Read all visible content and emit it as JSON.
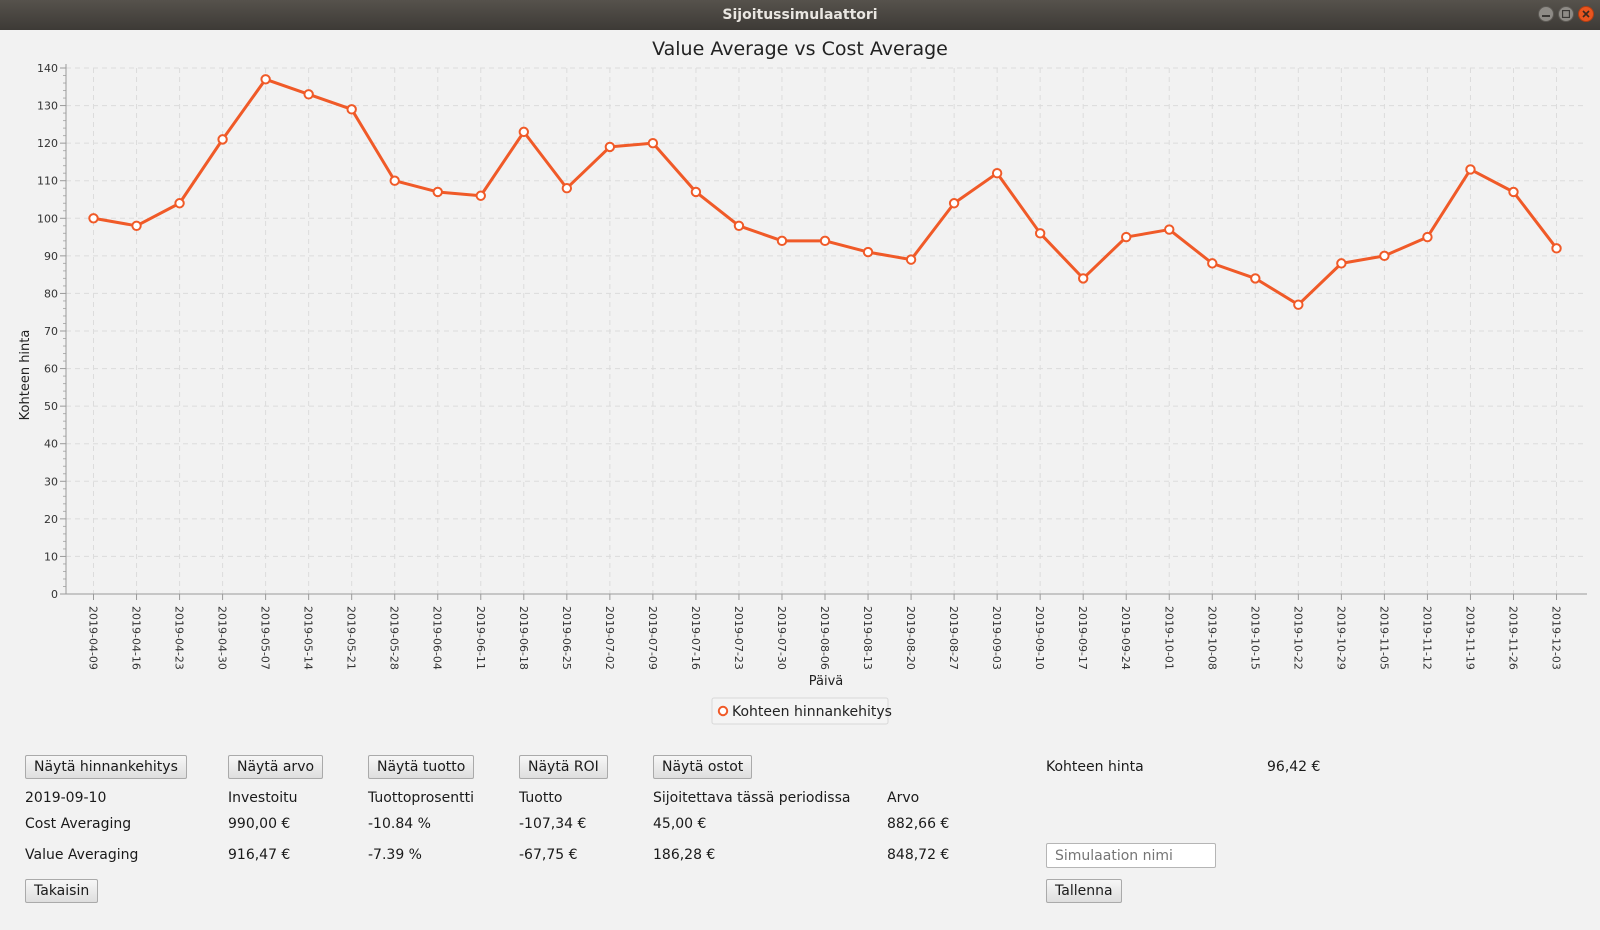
{
  "window": {
    "title": "Sijoitussimulaattori"
  },
  "chart_data": {
    "type": "line",
    "title": "Value Average vs Cost Average",
    "xlabel": "Päivä",
    "ylabel": "Kohteen hinta",
    "ylim": [
      0,
      140
    ],
    "yticks": [
      0,
      10,
      20,
      30,
      40,
      50,
      60,
      70,
      80,
      90,
      100,
      110,
      120,
      130,
      140
    ],
    "grid": true,
    "legend_position": "bottom",
    "categories": [
      "2019-04-09",
      "2019-04-16",
      "2019-04-23",
      "2019-04-30",
      "2019-05-07",
      "2019-05-14",
      "2019-05-21",
      "2019-05-28",
      "2019-06-04",
      "2019-06-11",
      "2019-06-18",
      "2019-06-25",
      "2019-07-02",
      "2019-07-09",
      "2019-07-16",
      "2019-07-23",
      "2019-07-30",
      "2019-08-06",
      "2019-08-13",
      "2019-08-20",
      "2019-08-27",
      "2019-09-03",
      "2019-09-10",
      "2019-09-17",
      "2019-09-24",
      "2019-10-01",
      "2019-10-08",
      "2019-10-15",
      "2019-10-22",
      "2019-10-29",
      "2019-11-05",
      "2019-11-12",
      "2019-11-19",
      "2019-11-26",
      "2019-12-03"
    ],
    "series": [
      {
        "name": "Kohteen hinnankehitys",
        "color": "#f05a28",
        "values": [
          100,
          98,
          104,
          121,
          137,
          133,
          129,
          110,
          107,
          106,
          123,
          108,
          119,
          120,
          107,
          98,
          94,
          94,
          91,
          89,
          104,
          112,
          96,
          84,
          95,
          97,
          88,
          84,
          77,
          88,
          90,
          95,
          113,
          107,
          92
        ]
      }
    ]
  },
  "buttons": {
    "show_price": "Näytä hinnankehitys",
    "show_value": "Näytä arvo",
    "show_return": "Näytä tuotto",
    "show_roi": "Näytä ROI",
    "show_purchases": "Näytä ostot",
    "back": "Takaisin",
    "save": "Tallenna"
  },
  "price": {
    "label": "Kohteen hinta",
    "value": "96,42 €"
  },
  "table": {
    "date": "2019-09-10",
    "headers": {
      "invested": "Investoitu",
      "return_pct": "Tuottoprosentti",
      "return": "Tuotto",
      "period_invest": "Sijoitettava tässä periodissa",
      "value": "Arvo"
    },
    "rows": [
      {
        "label": "Cost Averaging",
        "invested": "990,00 €",
        "return_pct": "-10.84 %",
        "return": "-107,34 €",
        "period_invest": "45,00 €",
        "value": "882,66 €"
      },
      {
        "label": "Value Averaging",
        "invested": "916,47 €",
        "return_pct": "-7.39 %",
        "return": "-67,75 €",
        "period_invest": "186,28 €",
        "value": "848,72 €"
      }
    ]
  },
  "simulation": {
    "placeholder": "Simulaation nimi",
    "value": ""
  },
  "icons": {
    "minimize": "minimize-icon",
    "maximize": "maximize-icon",
    "close": "close-icon"
  }
}
